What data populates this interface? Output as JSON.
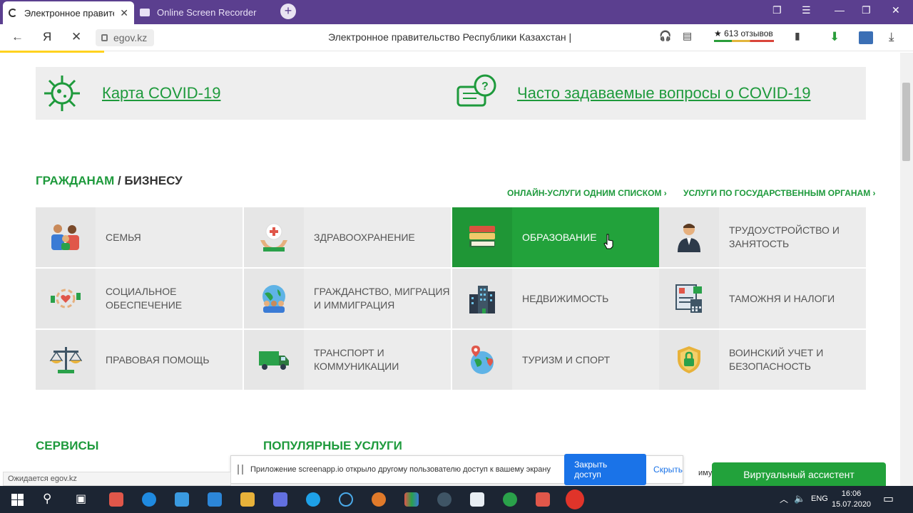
{
  "browser": {
    "tabs": [
      {
        "title": "Электронное правител",
        "active": true
      },
      {
        "title": "Online Screen Recorder",
        "active": false
      }
    ],
    "url": "egov.kz",
    "page_title": "Электронное правительство Республики Казахстан |",
    "reviews": "613 отзывов",
    "status_text": "Ожидается egov.kz"
  },
  "banners": {
    "covid_map": "Карта COVID-19",
    "covid_faq": "Часто задаваемые вопросы о COVID-19"
  },
  "section": {
    "citizens": "ГРАЖДАНАМ",
    "divider": " / ",
    "business": "БИЗНЕСУ",
    "online_services": "ОНЛАЙН-УСЛУГИ ОДНИМ СПИСКОМ ›",
    "services_by_agency": "УСЛУГИ ПО ГОСУДАРСТВЕННЫМ ОРГАНАМ ›"
  },
  "categories": [
    {
      "label": "СЕМЬЯ",
      "icon": "family-icon"
    },
    {
      "label": "ЗДРАВООХРАНЕНИЕ",
      "icon": "healthcare-icon"
    },
    {
      "label": "ОБРАЗОВАНИЕ",
      "icon": "books-icon",
      "active": true
    },
    {
      "label": "ТРУДОУСТРОЙСТВО И ЗАНЯТОСТЬ",
      "icon": "employee-icon"
    },
    {
      "label": "СОЦИАЛЬНОЕ ОБЕСПЕЧЕНИЕ",
      "icon": "social-care-icon"
    },
    {
      "label": "ГРАЖДАНСТВО, МИГРАЦИЯ И ИММИГРАЦИЯ",
      "icon": "globe-people-icon"
    },
    {
      "label": "НЕДВИЖИМОСТЬ",
      "icon": "buildings-icon"
    },
    {
      "label": "ТАМОЖНЯ И НАЛОГИ",
      "icon": "documents-calculator-icon"
    },
    {
      "label": "ПРАВОВАЯ ПОМОЩЬ",
      "icon": "scales-icon"
    },
    {
      "label": "ТРАНСПОРТ И КОММУНИКАЦИИ",
      "icon": "truck-icon"
    },
    {
      "label": "ТУРИЗМ И СПОРТ",
      "icon": "globe-pin-icon"
    },
    {
      "label": "ВОИНСКИЙ УЧЕТ И БЕЗОПАСНОСТЬ",
      "icon": "shield-lock-icon"
    }
  ],
  "bottom": {
    "services_title": "СЕРВИСЫ",
    "popular_title": "ПОПУЛЯРНЫЕ УСЛУГИ",
    "imu": "иму"
  },
  "notice": {
    "message": "Приложение screenapp.io открыло другому пользователю доступ к вашему экрану",
    "close_access": "Закрыть доступ",
    "hide": "Скрыть"
  },
  "assistant": "Виртуальный ассистент",
  "taskbar": {
    "lang": "ENG",
    "time": "16:06",
    "date": "15.07.2020"
  },
  "colors": {
    "brand_green": "#1e9a3c",
    "active_tile": "#22a23b",
    "tab_bar": "#5b3f8f"
  }
}
